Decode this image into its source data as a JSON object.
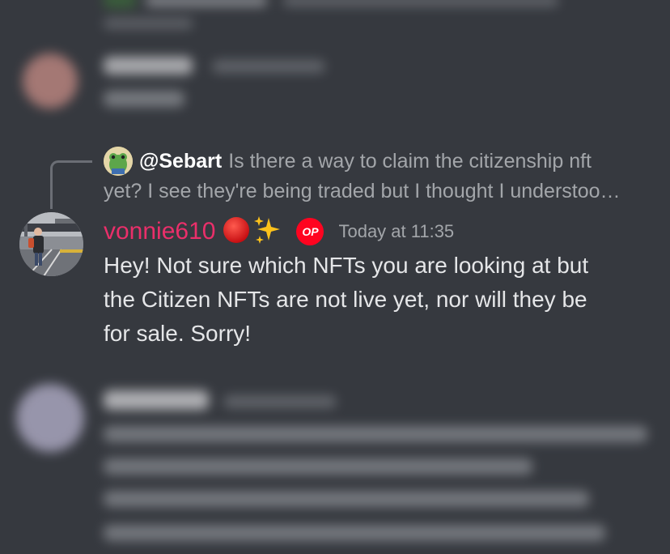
{
  "reply": {
    "mention": "@Sebart",
    "line1": "Is there a way to claim the citizenship nft",
    "line2": "yet? I see they're being traded but I thought I understoo…"
  },
  "message": {
    "author": "vonnie610",
    "badge": "OP",
    "timestamp": "Today at 11:35",
    "lines": [
      "Hey! Not sure which NFTs you are looking at but",
      "the Citizen NFTs are not live yet, nor will they be",
      "for sale. Sorry!"
    ]
  },
  "colors": {
    "background": "#36393f",
    "author": "#ea2f6a",
    "op_badge": "#ff0420"
  },
  "icons": {
    "status_circle": "red-circle-emoji",
    "sparkles": "sparkles-emoji"
  }
}
